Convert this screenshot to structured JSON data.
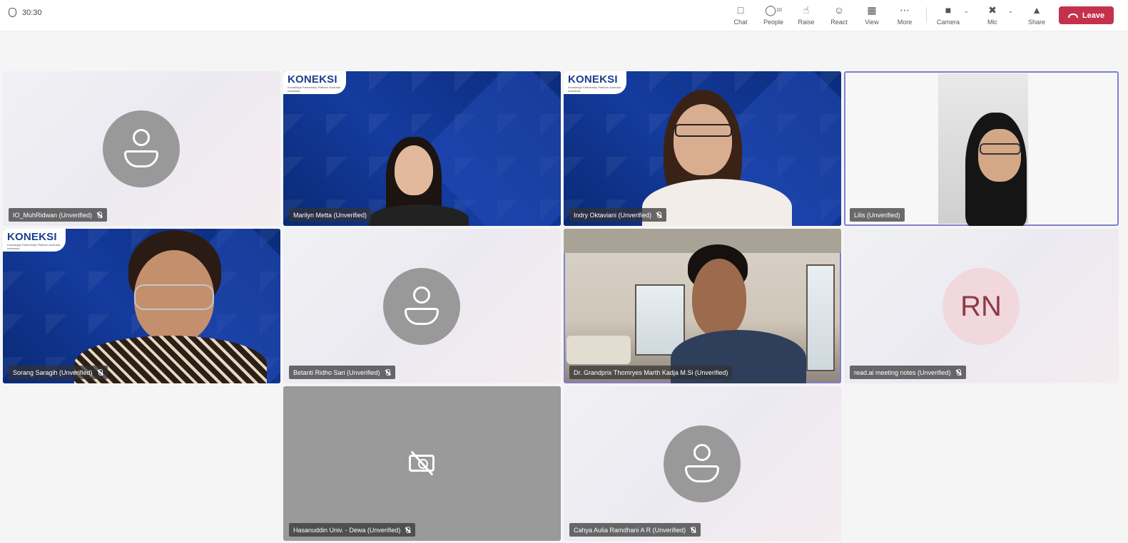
{
  "meeting": {
    "timer": "30:30"
  },
  "toolbar": {
    "chat": "Chat",
    "people": "People",
    "people_count": "10",
    "raise": "Raise",
    "react": "React",
    "view": "View",
    "more": "More",
    "camera": "Camera",
    "mic": "Mic",
    "share": "Share",
    "leave": "Leave"
  },
  "colors": {
    "leave_button": "#c4314b",
    "active_speaker_border": "#e7b844",
    "koneksi_blue": "#0d2f82"
  },
  "tiles": [
    {
      "name": "IO_MuhRidwan (Unverified)",
      "type": "avatar"
    },
    {
      "name": "Marilyn Metta (Unverified)",
      "type": "video",
      "logo": "KONEKSI"
    },
    {
      "name": "Indry Oktaviani (Unverified)",
      "type": "video",
      "logo": "KONEKSI",
      "active": true
    },
    {
      "name": "Lilis (Unverified)",
      "type": "video"
    },
    {
      "name": "Sorang Saragih (Unverified)",
      "type": "video",
      "logo": "KONEKSI"
    },
    {
      "name": "Betanti Ridho Sari (Unverified)",
      "type": "avatar"
    },
    {
      "name": "Dr. Grandprix Thomryes Marth Kadja M.Si (Unverified)",
      "type": "video"
    },
    {
      "name": "read.ai meeting notes (Unverified)",
      "type": "initials",
      "initials": "RN"
    },
    {
      "name": "Hasanuddin Univ. - Dewa (Unverified)",
      "type": "camera-off"
    },
    {
      "name": "Cahya Aulia Ramdhani A R (Unverified)",
      "type": "avatar"
    }
  ],
  "branding": {
    "logo_text": "KONEKSI",
    "logo_sub": "Knowledge Partnership Platform Australia - Indonesia"
  }
}
